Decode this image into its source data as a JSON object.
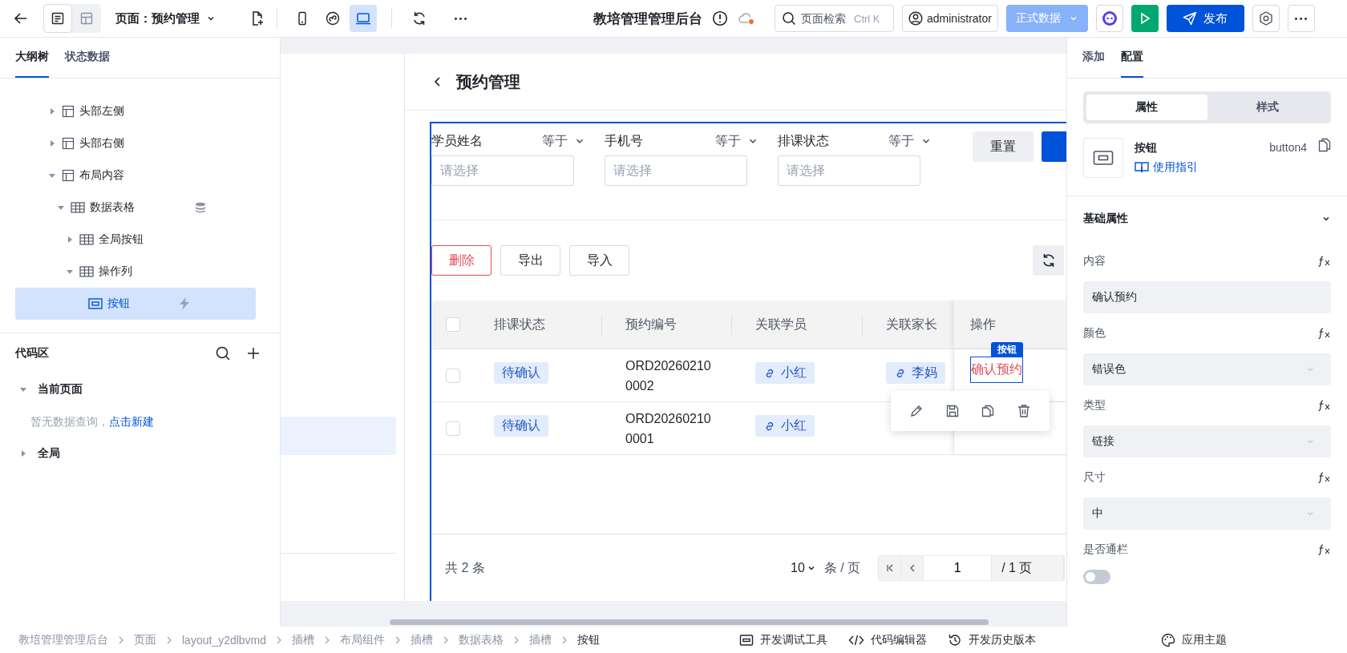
{
  "topbar": {
    "views": [
      {
        "kind": "outline",
        "selected": true
      },
      {
        "kind": "layout",
        "selected": false
      }
    ],
    "page_label": "页面：预约管理",
    "devices": [
      {
        "kind": "mobile",
        "selected": false
      },
      {
        "kind": "miniprogram",
        "selected": false
      },
      {
        "kind": "desktop",
        "selected": true
      }
    ],
    "app_title": "教培管理管理后台",
    "search": {
      "placeholder": "页面检索",
      "shortcut": "Ctrl K"
    },
    "user": "administrator",
    "env": "正式数据",
    "publish": "发布"
  },
  "left_panel": {
    "tabs": [
      {
        "label": "大纲树",
        "selected": true
      },
      {
        "label": "状态数据",
        "selected": false
      }
    ],
    "tree": [
      {
        "label": "头部左侧",
        "kind": "layout",
        "expanded": false,
        "selected": false
      },
      {
        "label": "头部右侧",
        "kind": "layout",
        "expanded": false,
        "selected": false
      },
      {
        "label": "布局内容",
        "kind": "layout",
        "expanded": true,
        "selected": false,
        "children": [
          {
            "label": "数据表格",
            "kind": "table",
            "expanded": true,
            "selected": false,
            "has_data_source": true,
            "children": [
              {
                "label": "全局按钮",
                "kind": "table",
                "expanded": false,
                "selected": false
              },
              {
                "label": "操作列",
                "kind": "table",
                "expanded": true,
                "selected": false,
                "children": [
                  {
                    "label": "按钮",
                    "kind": "button",
                    "selected": true,
                    "has_event": true
                  }
                ]
              }
            ]
          }
        ]
      }
    ],
    "code_area": {
      "title": "代码区",
      "groups": [
        {
          "label": "当前页面",
          "expanded": true,
          "empty_text": "暂无数据查询，",
          "link": "点击新建"
        },
        {
          "label": "全局",
          "expanded": false
        }
      ]
    }
  },
  "canvas": {
    "page_title": "预约管理",
    "filters": [
      {
        "label": "学员姓名",
        "operator": "等于",
        "placeholder": "请选择"
      },
      {
        "label": "手机号",
        "operator": "等于",
        "placeholder": "请选择"
      },
      {
        "label": "排课状态",
        "operator": "等于",
        "placeholder": "请选择"
      }
    ],
    "reset": "重置",
    "toolbar": [
      {
        "label": "删除",
        "kind": "danger"
      },
      {
        "label": "导出",
        "kind": "default"
      },
      {
        "label": "导入",
        "kind": "default"
      }
    ],
    "all_checked": false,
    "columns": [
      "排课状态",
      "预约编号",
      "关联学员",
      "关联家长",
      "操作"
    ],
    "rows": [
      {
        "checked": false,
        "status": "待确认",
        "order_no": "ORD202602100002",
        "student": "小红",
        "parent": "李妈",
        "action": "确认预约"
      },
      {
        "checked": false,
        "status": "待确认",
        "order_no": "ORD202602100001",
        "student": "小红"
      }
    ],
    "selection_badge": "按钮",
    "footer": {
      "total": "共 2 条",
      "page_size": "10",
      "per_page": "条 / 页",
      "page": "1",
      "pages": "/ 1 页"
    }
  },
  "right_panel": {
    "tabs": [
      {
        "label": "添加",
        "selected": false
      },
      {
        "label": "配置",
        "selected": true
      }
    ],
    "segments": [
      {
        "label": "属性",
        "selected": true
      },
      {
        "label": "样式",
        "selected": false
      }
    ],
    "component": {
      "name": "按钮",
      "id": "button4",
      "guide": "使用指引"
    },
    "section": {
      "title": "基础属性",
      "expanded": true
    },
    "props": [
      {
        "label": "内容",
        "kind": "text",
        "value": "确认预约"
      },
      {
        "label": "颜色",
        "kind": "select",
        "value": "错误色"
      },
      {
        "label": "类型",
        "kind": "select",
        "value": "链接"
      },
      {
        "label": "尺寸",
        "kind": "select",
        "value": "中"
      },
      {
        "label": "是否通栏",
        "kind": "switch",
        "on": false
      }
    ]
  },
  "status_bar": {
    "breadcrumb": [
      "教培管理管理后台",
      "页面",
      "layout_y2dlbvmd",
      "插槽",
      "布局组件",
      "插槽",
      "数据表格",
      "插槽",
      "按钮"
    ],
    "tools": [
      {
        "label": "开发调试工具",
        "kind": "debug"
      },
      {
        "label": "代码编辑器",
        "kind": "code"
      },
      {
        "label": "开发历史版本",
        "kind": "history"
      }
    ],
    "theme": "应用主题"
  }
}
